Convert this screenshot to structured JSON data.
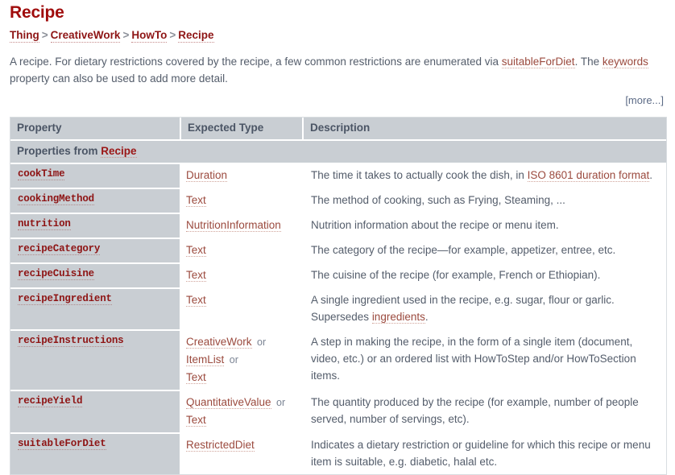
{
  "page": {
    "title": "Recipe"
  },
  "breadcrumb": {
    "separator": ">",
    "items": [
      {
        "label": "Thing"
      },
      {
        "label": "CreativeWork"
      },
      {
        "label": "HowTo"
      },
      {
        "label": "Recipe"
      }
    ]
  },
  "description": {
    "part1": "A recipe. For dietary restrictions covered by the recipe, a few common restrictions are enumerated via ",
    "link1": "suitableForDiet",
    "part2": ". The ",
    "link2": "keywords",
    "part3": " property can also be used to add more detail.",
    "more_label": "[more...]"
  },
  "table": {
    "headers": {
      "property": "Property",
      "expected_type": "Expected Type",
      "description": "Description"
    },
    "section_label_prefix": "Properties from ",
    "section_label_link": "Recipe",
    "rows": [
      {
        "property": "cookTime",
        "types": [
          {
            "name": "Duration",
            "or": false
          }
        ],
        "description_parts": [
          {
            "text": "The time it takes to actually cook the dish, in ",
            "link": false
          },
          {
            "text": "ISO 8601 duration format",
            "link": true
          },
          {
            "text": ".",
            "link": false
          }
        ]
      },
      {
        "property": "cookingMethod",
        "types": [
          {
            "name": "Text",
            "or": false
          }
        ],
        "description_parts": [
          {
            "text": "The method of cooking, such as Frying, Steaming, ...",
            "link": false
          }
        ]
      },
      {
        "property": "nutrition",
        "types": [
          {
            "name": "NutritionInformation",
            "or": false
          }
        ],
        "description_parts": [
          {
            "text": "Nutrition information about the recipe or menu item.",
            "link": false
          }
        ]
      },
      {
        "property": "recipeCategory",
        "types": [
          {
            "name": "Text",
            "or": false
          }
        ],
        "description_parts": [
          {
            "text": "The category of the recipe—for example, appetizer, entree, etc.",
            "link": false
          }
        ]
      },
      {
        "property": "recipeCuisine",
        "types": [
          {
            "name": "Text",
            "or": false
          }
        ],
        "description_parts": [
          {
            "text": "The cuisine of the recipe (for example, French or Ethiopian).",
            "link": false
          }
        ]
      },
      {
        "property": "recipeIngredient",
        "types": [
          {
            "name": "Text",
            "or": false
          }
        ],
        "description_parts": [
          {
            "text": "A single ingredient used in the recipe, e.g. sugar, flour or garlic. Supersedes ",
            "link": false
          },
          {
            "text": "ingredients",
            "link": true
          },
          {
            "text": ".",
            "link": false
          }
        ]
      },
      {
        "property": "recipeInstructions",
        "types": [
          {
            "name": "CreativeWork",
            "or": true
          },
          {
            "name": "ItemList",
            "or": true
          },
          {
            "name": "Text",
            "or": false
          }
        ],
        "description_parts": [
          {
            "text": "A step in making the recipe, in the form of a single item (document, video, etc.) or an ordered list with HowToStep and/or HowToSection items.",
            "link": false
          }
        ]
      },
      {
        "property": "recipeYield",
        "types": [
          {
            "name": "QuantitativeValue",
            "or": true
          },
          {
            "name": "Text",
            "or": false
          }
        ],
        "description_parts": [
          {
            "text": "The quantity produced by the recipe (for example, number of people served, number of servings, etc).",
            "link": false
          }
        ]
      },
      {
        "property": "suitableForDiet",
        "types": [
          {
            "name": "RestrictedDiet",
            "or": false
          }
        ],
        "description_parts": [
          {
            "text": "Indicates a dietary restriction or guideline for which this recipe or menu item is suitable, e.g. diabetic, halal etc.",
            "link": false
          }
        ]
      }
    ],
    "or_label": "or"
  }
}
